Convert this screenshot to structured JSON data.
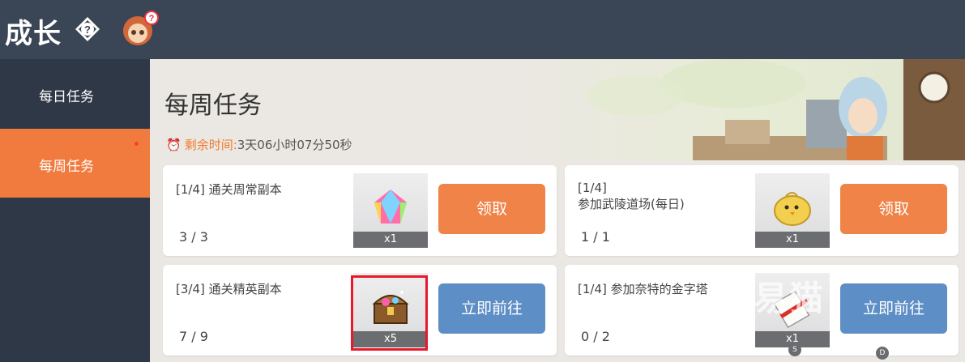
{
  "header": {
    "title": "成长"
  },
  "sidebar": {
    "items": [
      {
        "label": "每日任务"
      },
      {
        "label": "每周任务"
      }
    ]
  },
  "main": {
    "title": "每周任务",
    "timer": {
      "label": "剩余时间:",
      "value": "3天06小时07分50秒"
    }
  },
  "tasks": [
    {
      "title": "[1/4] 通关周常副本",
      "progress": "3 / 3",
      "reward_qty": "x1",
      "reward_icon": "rainbow-gem-icon",
      "button": "领取",
      "button_color": "#f08348"
    },
    {
      "title": "[1/4]\n参加武陵道场(每日)",
      "progress": "1 / 1",
      "reward_qty": "x1",
      "reward_icon": "yellow-chick-icon",
      "button": "领取",
      "button_color": "#f08348"
    },
    {
      "title": "[3/4] 通关精英副本",
      "progress": "7 / 9",
      "reward_qty": "x5",
      "reward_icon": "treasure-chest-icon",
      "button": "立即前往",
      "button_color": "#5d8ec5"
    },
    {
      "title": "[1/4] 参加奈特的金字塔",
      "progress": "0 / 2",
      "reward_qty": "x1",
      "reward_icon": "scroll-icon",
      "button": "立即前往",
      "button_color": "#5d8ec5"
    }
  ],
  "watermark": "易猫",
  "badges": [
    "S",
    "D"
  ]
}
